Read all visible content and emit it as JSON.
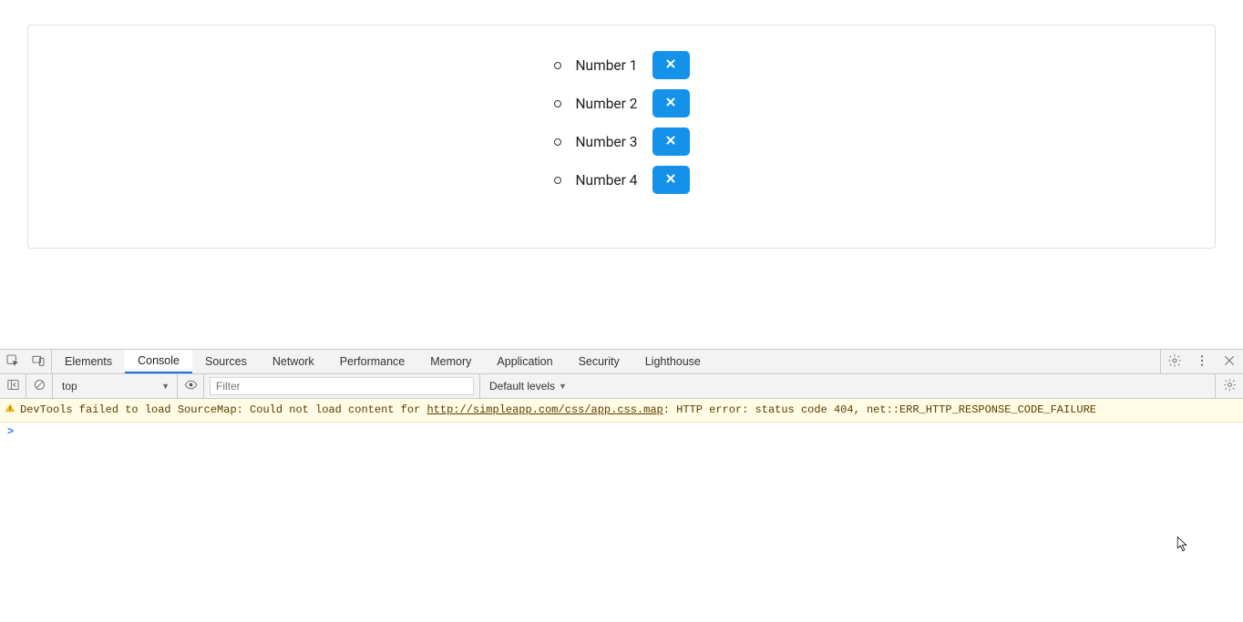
{
  "card": {
    "items": [
      {
        "label": "Number 1"
      },
      {
        "label": "Number 2"
      },
      {
        "label": "Number 3"
      },
      {
        "label": "Number 4"
      }
    ]
  },
  "devtools": {
    "tabs": [
      "Elements",
      "Console",
      "Sources",
      "Network",
      "Performance",
      "Memory",
      "Application",
      "Security",
      "Lighthouse"
    ],
    "active_tab_index": 1,
    "toolbar": {
      "context": "top",
      "filter_placeholder": "Filter",
      "levels_label": "Default levels"
    },
    "console": {
      "warning": {
        "prefix": "DevTools failed to load SourceMap: Could not load content for ",
        "url": "http://simpleapp.com/css/app.css.map",
        "suffix": ": HTTP error: status code 404, net::ERR_HTTP_RESPONSE_CODE_FAILURE"
      },
      "prompt": ">"
    }
  }
}
